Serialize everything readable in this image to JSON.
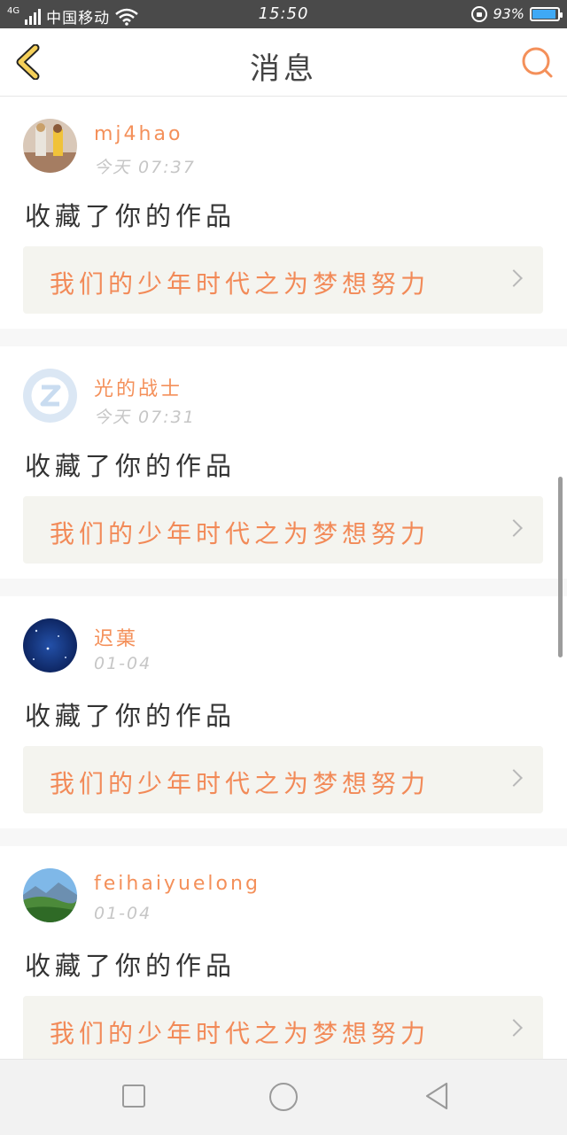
{
  "status_bar": {
    "network": "4G",
    "carrier": "中国移动",
    "time": "15:50",
    "battery": "93%",
    "battery_level": 0.93,
    "icons": [
      "signal-icon",
      "wifi-icon",
      "rotation-lock-icon",
      "battery-icon"
    ]
  },
  "header": {
    "title": "消息",
    "back_icon": "chevron-left-icon",
    "search_icon": "search-icon",
    "accent_color": "#f4905a",
    "back_color": "#f5d05a"
  },
  "messages": [
    {
      "username": "mj4hao",
      "time": "今天 07:37",
      "action": "收藏了你的作品",
      "work_title": "我们的少年时代之为梦想努力",
      "avatar": "photo-avatar"
    },
    {
      "username": "光的战士",
      "time": "今天 07:31",
      "action": "收藏了你的作品",
      "work_title": "我们的少年时代之为梦想努力",
      "avatar": "default-avatar"
    },
    {
      "username": "迟菓",
      "time": "01-04",
      "action": "收藏了你的作品",
      "work_title": "我们的少年时代之为梦想努力",
      "avatar": "starry-sky-avatar"
    },
    {
      "username": "feihaiyuelong",
      "time": "01-04",
      "action": "收藏了你的作品",
      "work_title": "我们的少年时代之为梦想努力",
      "avatar": "landscape-avatar"
    }
  ],
  "nav_bar": {
    "icons": [
      "recent-apps-icon",
      "home-icon",
      "back-triangle-icon"
    ]
  }
}
